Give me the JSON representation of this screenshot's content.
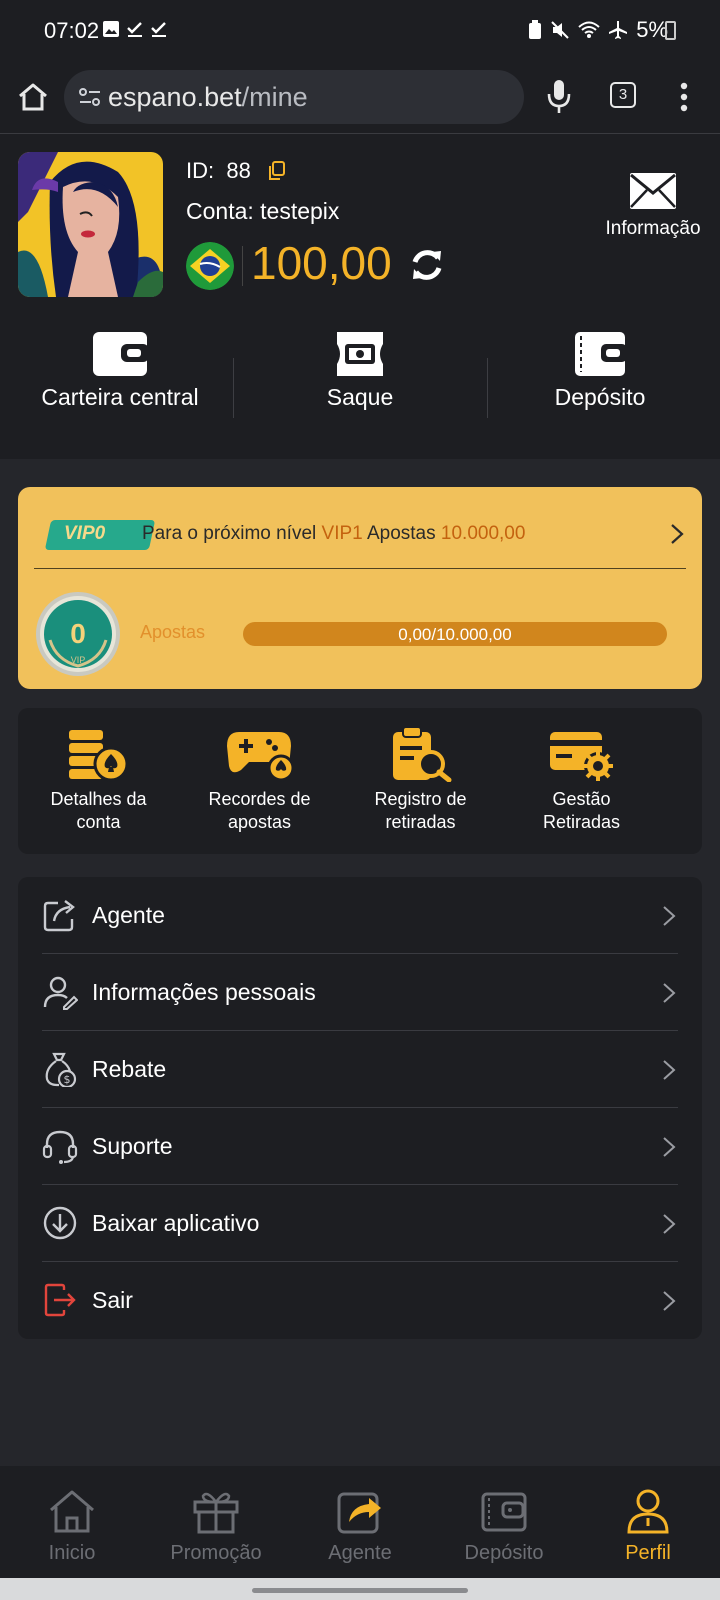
{
  "status_bar": {
    "time": "07:02",
    "battery": "5%"
  },
  "browser": {
    "url_domain": "espano.bet",
    "url_path": "/mine",
    "tab_count": "3"
  },
  "profile": {
    "id_label": "ID:",
    "id_value": "88",
    "account": "Conta: testepix",
    "balance": "100,00",
    "info_label": "Informação"
  },
  "wallet_actions": [
    {
      "label": "Carteira central"
    },
    {
      "label": "Saque"
    },
    {
      "label": "Depósito"
    }
  ],
  "vip": {
    "badge": "VIP0",
    "next_prefix": "Para o próximo nível",
    "next_level": "VIP1",
    "bets_word": "Apostas",
    "target": "10.000,00",
    "medal_level": "0",
    "medal_text": "VIP",
    "progress_label": "Apostas",
    "progress_text": "0,00/10.000,00",
    "progress_fraction": 0.0
  },
  "quick_links": [
    {
      "label": "Detalhes da\nconta"
    },
    {
      "label": "Recordes de\napostas"
    },
    {
      "label": "Registro de\nretiradas"
    },
    {
      "label": "Gestão\nRetiradas"
    }
  ],
  "menu": [
    {
      "label": "Agente",
      "icon": "share-box-icon"
    },
    {
      "label": "Informações pessoais",
      "icon": "user-edit-icon"
    },
    {
      "label": "Rebate",
      "icon": "money-bag-icon"
    },
    {
      "label": "Suporte",
      "icon": "headset-icon"
    },
    {
      "label": "Baixar aplicativo",
      "icon": "download-icon"
    },
    {
      "label": "Sair",
      "icon": "logout-icon"
    }
  ],
  "bottom_nav": [
    {
      "label": "Inicio",
      "active": false
    },
    {
      "label": "Promoção",
      "active": false
    },
    {
      "label": "Agente",
      "active": false
    },
    {
      "label": "Depósito",
      "active": false
    },
    {
      "label": "Perfil",
      "active": true
    }
  ],
  "colors": {
    "accent": "#f4b328",
    "vip_card": "#f1c15b",
    "background": "#25262b",
    "panel": "#1d1e22"
  }
}
